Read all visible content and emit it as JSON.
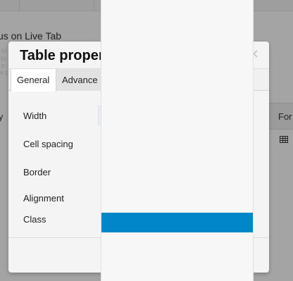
{
  "background": {
    "heading": "us on Live Tab",
    "faint_lines": [
      "ld",
      "to",
      "e",
      "e p"
    ],
    "left_label": "y",
    "right_column_header": "For",
    "table_icon": "table-icon"
  },
  "modal": {
    "title": "Table proper",
    "close_icon": "close-icon",
    "tabs": [
      {
        "label": "General",
        "active": true
      },
      {
        "label": "Advance",
        "active": false
      }
    ],
    "fields": [
      {
        "label": "Width"
      },
      {
        "label": "Cell spacing"
      },
      {
        "label": "Border"
      },
      {
        "label": "Alignment"
      },
      {
        "label": "Class"
      }
    ]
  },
  "dropdown": {
    "items": [
      {
        "label": "",
        "selected": true
      }
    ]
  },
  "colors": {
    "overlay": "#a4a4a4",
    "modal_bg": "#f4f4f4",
    "selected_item": "#0086c9",
    "dropdown_bg": "#f7f7f7"
  }
}
